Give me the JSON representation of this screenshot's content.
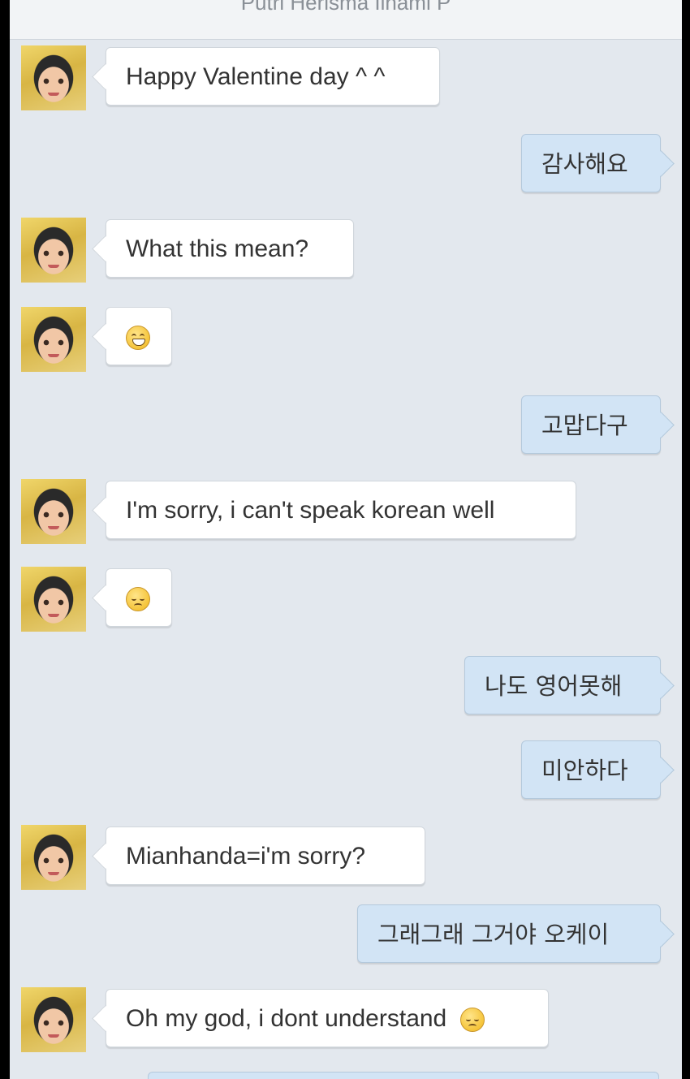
{
  "header": {
    "contact_name": "Putri Herisma Ilhami P"
  },
  "messages": [
    {
      "direction": "in",
      "text": "Happy Valentine day ^ ^"
    },
    {
      "direction": "out",
      "text": "감사해요"
    },
    {
      "direction": "in",
      "text": "What this mean?"
    },
    {
      "direction": "in",
      "emoji": "grinning-face-emoji"
    },
    {
      "direction": "out",
      "text": "고맙다구"
    },
    {
      "direction": "in",
      "text": "I'm sorry, i can't speak korean well"
    },
    {
      "direction": "in",
      "emoji": "disappointed-face-emoji"
    },
    {
      "direction": "out",
      "text": "나도 영어못해"
    },
    {
      "direction": "out",
      "text": "미안하다"
    },
    {
      "direction": "in",
      "text": "Mianhanda=i'm sorry?"
    },
    {
      "direction": "out",
      "text": "그래그래 그거야 오케이"
    },
    {
      "direction": "in",
      "text": "Oh my god, i dont understand",
      "emoji": "disappointed-face-emoji"
    }
  ],
  "colors": {
    "background": "#e3e8ee",
    "incoming_bubble": "#ffffff",
    "outgoing_bubble": "#d2e4f5",
    "title_text": "#8a9097"
  }
}
